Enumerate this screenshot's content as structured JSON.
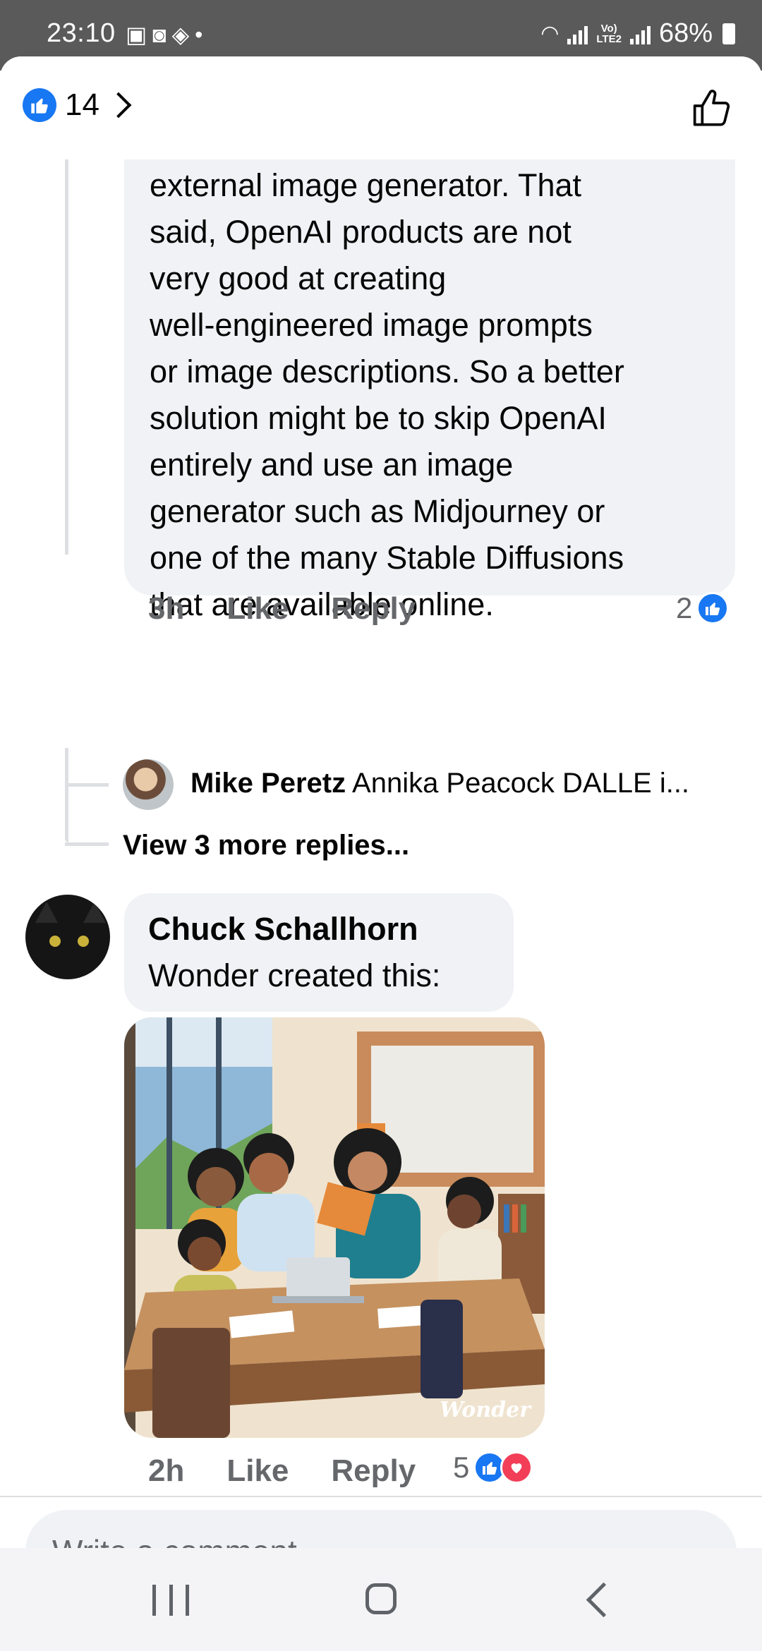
{
  "status_bar": {
    "time": "23:10",
    "notification_icons": [
      "gallery-icon",
      "camera-icon",
      "dropbox-icon",
      "dot-icon"
    ],
    "battery": "68%",
    "network": "LTE2"
  },
  "header": {
    "reaction_count": "14",
    "reaction_icon": "like-icon"
  },
  "comments": [
    {
      "text_lines": [
        "external image generator.  That",
        "said, OpenAI products are not",
        "very good at creating",
        "well-engineered image prompts",
        "or image descriptions. So a better",
        "solution might be to skip OpenAI",
        "entirely and use an image",
        "generator such as Midjourney or",
        "one of the many Stable Diffusions",
        "that are available online."
      ],
      "time": "3h",
      "like_label": "Like",
      "reply_label": "Reply",
      "reaction_count": "2",
      "reply_preview": {
        "author": "Mike Peretz",
        "snippet": "Annika Peacock DALLE i..."
      },
      "view_more_label": "View 3 more replies..."
    },
    {
      "author": "Chuck Schallhorn",
      "text": "Wonder created this:",
      "image_watermark": "Wonder",
      "time": "2h",
      "like_label": "Like",
      "reply_label": "Reply",
      "reaction_count": "5"
    }
  ],
  "composer": {
    "placeholder": "Write a comment..."
  },
  "colors": {
    "brand_blue": "#1877f2",
    "love_red": "#f33e58",
    "bubble_bg": "#f0f2f5",
    "secondary_text": "#65676b"
  }
}
